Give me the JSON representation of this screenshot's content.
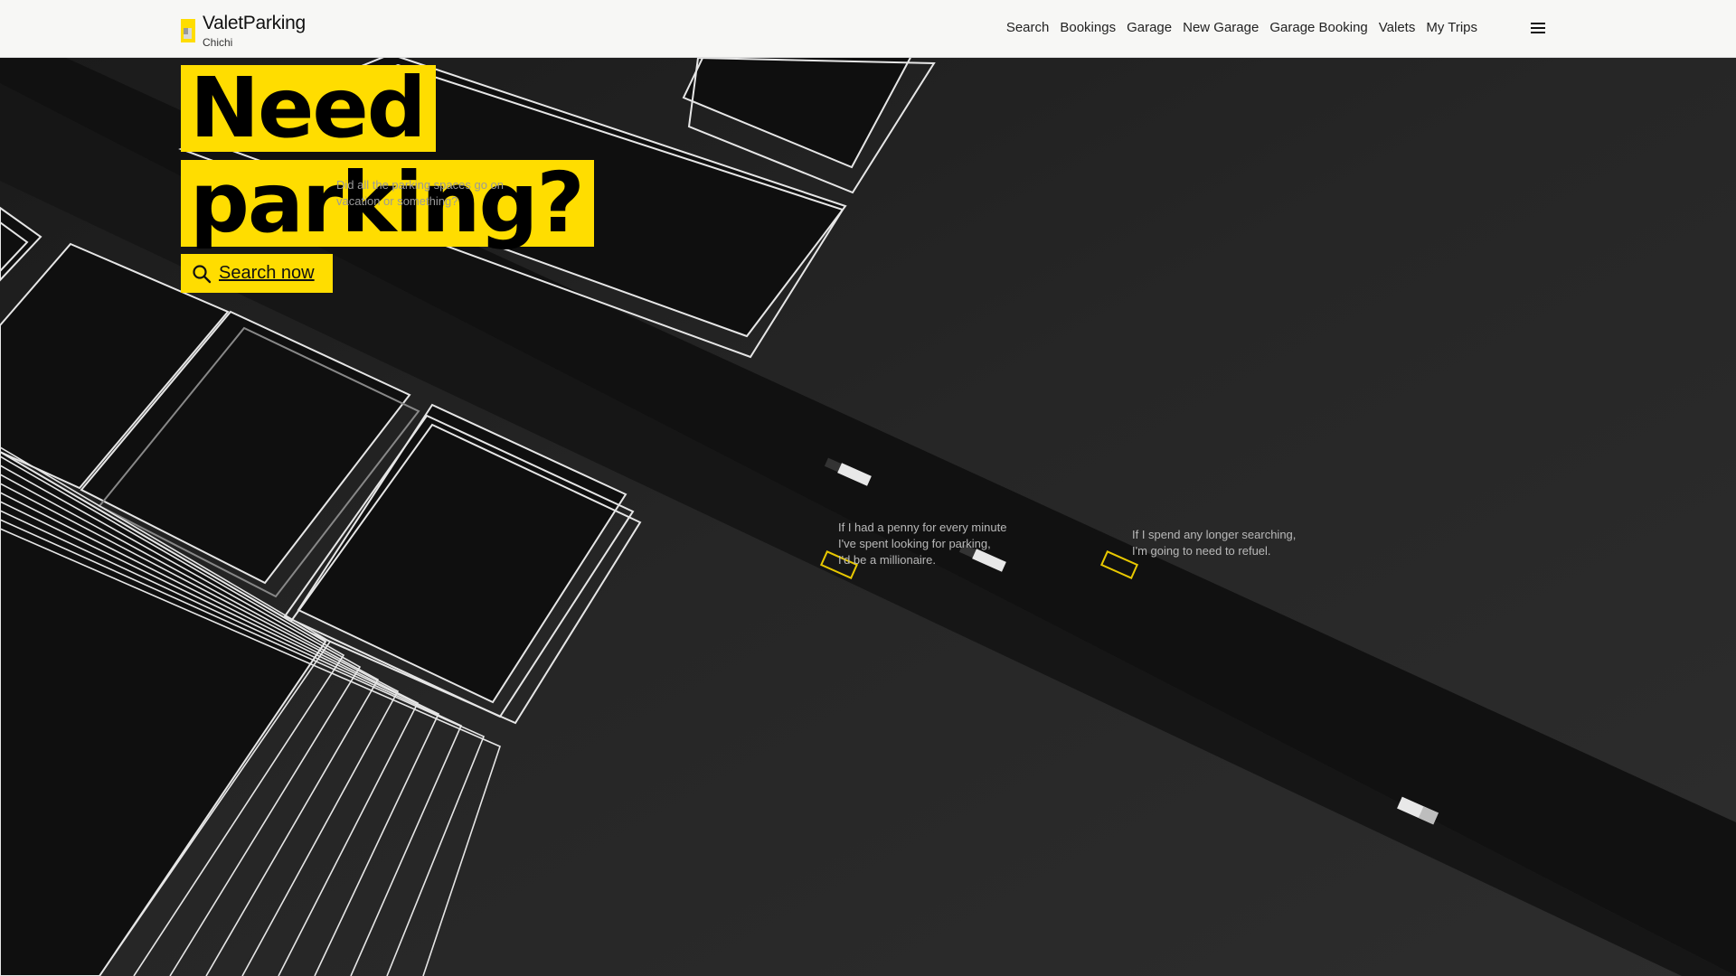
{
  "header": {
    "brand": "ValetParking",
    "subtitle": "Chichi",
    "nav": [
      "Search",
      "Bookings",
      "Garage",
      "New Garage",
      "Garage Booking",
      "Valets",
      "My Trips"
    ]
  },
  "hero": {
    "line1": "Need",
    "line2": "parking?",
    "search_label": "Search now"
  },
  "bubbles": [
    "Did all the parking spaces go on\nvacation or something?",
    "If I had a penny for every minute\nI've spent looking for parking,\nI'd be a millionaire.",
    "If I spend any longer searching,\nI'm going to need to refuel."
  ],
  "icons": {
    "logo": "parking-sign-icon",
    "search": "search-icon",
    "menu": "hamburger-menu-icon"
  },
  "colors": {
    "accent": "#ffdd00",
    "background": "#242424",
    "road": "#111111",
    "header": "#f7f7f5"
  }
}
